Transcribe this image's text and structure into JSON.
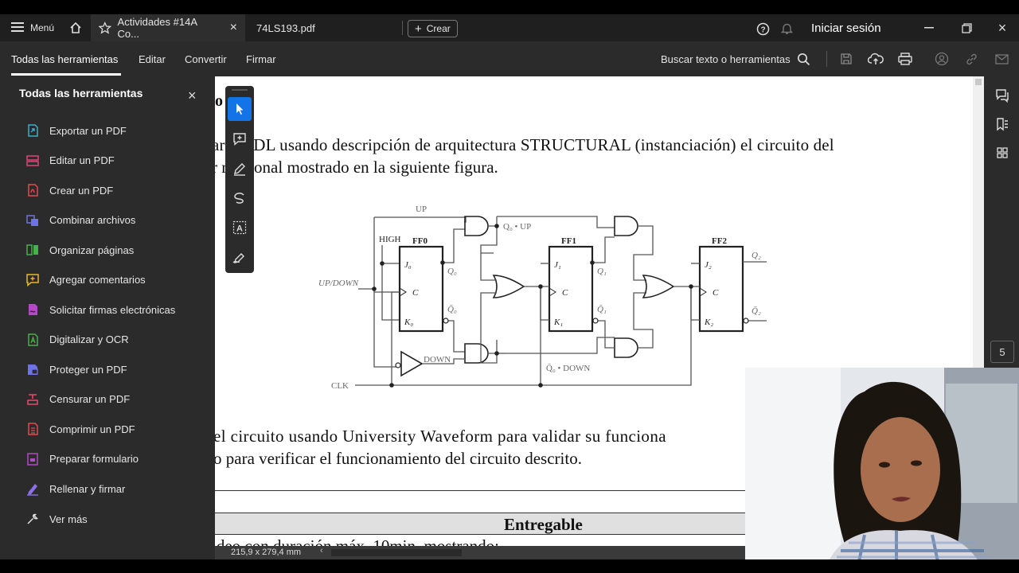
{
  "tabs": {
    "menu_label": "Menú",
    "tab1_label": "Actividades #14A Co...",
    "tab2_label": "74LS193.pdf",
    "create_label": "Crear",
    "signin_label": "Iniciar sesión"
  },
  "toolbar": {
    "items": [
      "Todas las herramientas",
      "Editar",
      "Convertir",
      "Firmar"
    ],
    "search_label": "Buscar texto o herramientas"
  },
  "sidebar": {
    "title": "Todas las herramientas",
    "items": [
      {
        "label": "Exportar un PDF",
        "icon": "export-pdf-icon",
        "color": "#3ab0c8"
      },
      {
        "label": "Editar un PDF",
        "icon": "edit-pdf-icon",
        "color": "#e0457b"
      },
      {
        "label": "Crear un PDF",
        "icon": "create-pdf-icon",
        "color": "#e84a4a"
      },
      {
        "label": "Combinar archivos",
        "icon": "combine-files-icon",
        "color": "#6d72e8"
      },
      {
        "label": "Organizar páginas",
        "icon": "organize-pages-icon",
        "color": "#48b04a"
      },
      {
        "label": "Agregar comentarios",
        "icon": "add-comments-icon",
        "color": "#e8b923"
      },
      {
        "label": "Solicitar firmas electrónicas",
        "icon": "request-signatures-icon",
        "color": "#b548c8"
      },
      {
        "label": "Digitalizar y OCR",
        "icon": "scan-ocr-icon",
        "color": "#48b04a"
      },
      {
        "label": "Proteger un PDF",
        "icon": "protect-pdf-icon",
        "color": "#6d72e8"
      },
      {
        "label": "Censurar un PDF",
        "icon": "redact-pdf-icon",
        "color": "#e84a6a"
      },
      {
        "label": "Comprimir un PDF",
        "icon": "compress-pdf-icon",
        "color": "#e84a4a"
      },
      {
        "label": "Preparar formulario",
        "icon": "prepare-form-icon",
        "color": "#b548c8"
      },
      {
        "label": "Rellenar y firmar",
        "icon": "fill-sign-icon",
        "color": "#8d6fe8"
      }
    ],
    "more_label": "Ver más"
  },
  "document": {
    "heading_fragment": "o",
    "line1": "ar   VHDL usando descripción de arquitectura STRUCTURAL (instanciación) el circuito del",
    "line2": "r  reccional mostrado en la siguiente figura.",
    "line3": "el  circuito  usando  University  Waveform  para  validar  su  funciona",
    "line4": "o para verificar el funcionamiento del circuito descrito.",
    "table_header": "Entregable",
    "line5": "ideo con duración máx. 10min. mostrando:"
  },
  "circuit": {
    "up": "UP",
    "q0_up": "Q₀ • UP",
    "high": "HIGH",
    "ff0": "FF0",
    "ff1": "FF1",
    "ff2": "FF2",
    "j0": "J₀",
    "k0": "K₀",
    "j1": "J₁",
    "k1": "K₁",
    "j2": "J₂",
    "k2": "K₂",
    "c": "C",
    "q0": "Q₀",
    "q0bar": "Q̄₀",
    "q1": "Q₁",
    "q1bar": "Q̄₁",
    "q2": "Q₂",
    "q2bar": "Q̄₂",
    "updown": "UP/DOWN",
    "down": "DOWN",
    "q0bar_down": "Q̄₀ • DOWN",
    "clk": "CLK"
  },
  "status": {
    "page_size": "215,9 x 279,4 mm",
    "page_number": "5"
  }
}
